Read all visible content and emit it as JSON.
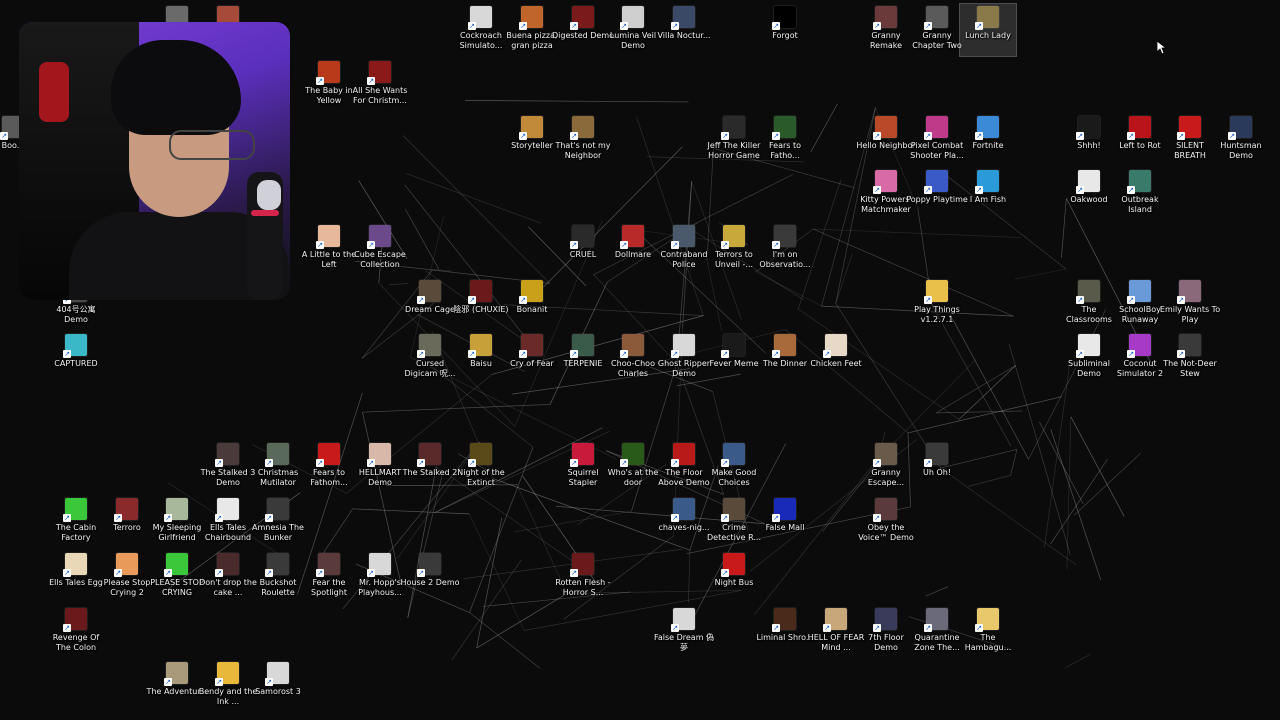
{
  "icons": [
    {
      "label": "Cockroach Simulato...",
      "color": "#d8d8d8"
    },
    {
      "label": "Buena pizza, gran pizza",
      "color": "#c0662c"
    },
    {
      "label": "Digested Demo",
      "color": "#7a1a1a"
    },
    {
      "label": "Lumina Veil Demo",
      "color": "#cfcfcf"
    },
    {
      "label": "Villa Noctur...",
      "color": "#3a4a66"
    },
    {
      "label": "Forgot",
      "color": "#000000"
    },
    {
      "label": "Granny Remake",
      "color": "#6a3a3a"
    },
    {
      "label": "Granny Chapter Two",
      "color": "#5a5a5a"
    },
    {
      "label": "Lunch Lady",
      "color": "#8a7a4a"
    },
    {
      "label": "The Baby in Yellow",
      "color": "#b83a1a"
    },
    {
      "label": "All She Wants For Christm...",
      "color": "#8a1a1a"
    },
    {
      "label": "Storyteller",
      "color": "#c08a3a"
    },
    {
      "label": "That's not my Neighbor",
      "color": "#8a6a3a"
    },
    {
      "label": "Jeff The Killer Horror Game",
      "color": "#2a2a2a"
    },
    {
      "label": "Fears to Fatho...",
      "color": "#2a5a2a"
    },
    {
      "label": "Hello Neighbor",
      "color": "#b84a2a"
    },
    {
      "label": "Pixel Combat Shooter Pla...",
      "color": "#c03a8a"
    },
    {
      "label": "Fortnite",
      "color": "#3a8ad8"
    },
    {
      "label": "Shhh!",
      "color": "#1a1a1a"
    },
    {
      "label": "Left to Rot",
      "color": "#b8141a"
    },
    {
      "label": "SILENT BREATH",
      "color": "#c81a1a"
    },
    {
      "label": "Huntsman Demo",
      "color": "#2a3a5a"
    },
    {
      "label": "Kitty Powers' Matchmaker",
      "color": "#d86aa8"
    },
    {
      "label": "Poppy Playtime",
      "color": "#3a5ac8"
    },
    {
      "label": "I Am Fish",
      "color": "#2a9ad8"
    },
    {
      "label": "Oakwood",
      "color": "#e8e8e8"
    },
    {
      "label": "Outbreak Island",
      "color": "#3a7a6a"
    },
    {
      "label": "A Little to the Left",
      "color": "#e8b89a"
    },
    {
      "label": "Cube Escape Collection",
      "color": "#6a4a8a"
    },
    {
      "label": "CRUEL",
      "color": "#2a2a2a"
    },
    {
      "label": "Dollmare",
      "color": "#b82a2a"
    },
    {
      "label": "Contraband Police",
      "color": "#4a5a6a"
    },
    {
      "label": "Terrors to Unveil -...",
      "color": "#c8a83a"
    },
    {
      "label": "I'm on Observatio...",
      "color": "#3a3a3a"
    },
    {
      "label": "404号公寓 Demo",
      "color": "#4a4a4a"
    },
    {
      "label": "CAPTURED",
      "color": "#3ab8c8"
    },
    {
      "label": "Dream Cage",
      "color": "#5a4a3a"
    },
    {
      "label": "陰邪 (CHUXIE)",
      "color": "#6a1a1a"
    },
    {
      "label": "Bonanit",
      "color": "#c8a01a"
    },
    {
      "label": "Play Things v1.2.7.1",
      "color": "#e8c04a"
    },
    {
      "label": "The Classrooms",
      "color": "#5a5a4a"
    },
    {
      "label": "SchoolBoy Runaway",
      "color": "#6a9ad8"
    },
    {
      "label": "Emily Wants To Play",
      "color": "#8a6a7a"
    },
    {
      "label": "Cursed Digicam 呪...",
      "color": "#6a6a5a"
    },
    {
      "label": "Baisu",
      "color": "#c8a03a"
    },
    {
      "label": "Cry of Fear",
      "color": "#6a2a2a"
    },
    {
      "label": "TERPENIE",
      "color": "#3a5a4a"
    },
    {
      "label": "Choo-Choo Charles",
      "color": "#8a5a3a"
    },
    {
      "label": "Ghost Ripper Demo",
      "color": "#d8d8d8"
    },
    {
      "label": "Fever Meme",
      "color": "#1a1a1a"
    },
    {
      "label": "The Dinner",
      "color": "#a86a3a"
    },
    {
      "label": "Chicken Feet",
      "color": "#e8d8c8"
    },
    {
      "label": "Subliminal Demo",
      "color": "#e8e8e8"
    },
    {
      "label": "Coconut Simulator 2",
      "color": "#a83ac8"
    },
    {
      "label": "The Not-Deer Stew",
      "color": "#3a3a3a"
    },
    {
      "label": "The Stalked 3 Demo",
      "color": "#4a3a3a"
    },
    {
      "label": "Christmas Mutilator",
      "color": "#5a6a5a"
    },
    {
      "label": "Fears to Fathom...",
      "color": "#c81a1a"
    },
    {
      "label": "HELLMART Demo",
      "color": "#d8b8a8"
    },
    {
      "label": "The Stalked 2",
      "color": "#5a2a2a"
    },
    {
      "label": "Night of the Extinct",
      "color": "#5a4a1a"
    },
    {
      "label": "Squirrel Stapler",
      "color": "#c81a3a"
    },
    {
      "label": "Who's at the door",
      "color": "#2a5a1a"
    },
    {
      "label": "The Floor Above Demo",
      "color": "#b81a1a"
    },
    {
      "label": "Make Good Choices",
      "color": "#3a5a8a"
    },
    {
      "label": "Granny Escape...",
      "color": "#6a5a4a"
    },
    {
      "label": "Uh Oh!",
      "color": "#3a3a3a"
    },
    {
      "label": "The Cabin Factory",
      "color": "#3ac83a"
    },
    {
      "label": "Terroro",
      "color": "#8a2a2a"
    },
    {
      "label": "My Sleeping Girlfriend",
      "color": "#a8b89a"
    },
    {
      "label": "Ells Tales Chairbound",
      "color": "#e8e8e8"
    },
    {
      "label": "Amnesia The Bunker",
      "color": "#3a3a3a"
    },
    {
      "label": "chaves-nig...",
      "color": "#3a5a8a"
    },
    {
      "label": "Crime Detective R...",
      "color": "#5a4a3a"
    },
    {
      "label": "False Mall",
      "color": "#1a2ab8"
    },
    {
      "label": "Obey the Voice™ Demo",
      "color": "#5a3a3a"
    },
    {
      "label": "Ells Tales Egg",
      "color": "#e8d8b8"
    },
    {
      "label": "Please Stop Crying 2",
      "color": "#e89a5a"
    },
    {
      "label": "PLEASE STOP CRYING",
      "color": "#3ac83a"
    },
    {
      "label": "Don't drop the cake ...",
      "color": "#4a2a2a"
    },
    {
      "label": "Buckshot Roulette",
      "color": "#3a3a3a"
    },
    {
      "label": "Fear the Spotlight",
      "color": "#5a3a3a"
    },
    {
      "label": "Mr. Hopp's Playhous...",
      "color": "#d8d8d8"
    },
    {
      "label": "House 2 Demo",
      "color": "#3a3a3a"
    },
    {
      "label": "Rotten Flesh - Horror S...",
      "color": "#6a1a1a"
    },
    {
      "label": "Night Bus",
      "color": "#c81a1a"
    },
    {
      "label": "Revenge Of The Colon",
      "color": "#6a1a1a"
    },
    {
      "label": "False Dream 偽夢",
      "color": "#d8d8d8"
    },
    {
      "label": "Liminal Shro...",
      "color": "#4a2a1a"
    },
    {
      "label": "HELL OF FEAR Mind ...",
      "color": "#c8a87a"
    },
    {
      "label": "7th Floor Demo",
      "color": "#3a3a5a"
    },
    {
      "label": "Quarantine Zone The...",
      "color": "#6a6a7a"
    },
    {
      "label": "The Hambagu...",
      "color": "#e8c86a"
    },
    {
      "label": "The Adventur...",
      "color": "#a89a7a"
    },
    {
      "label": "Bendy and the Ink ...",
      "color": "#e8b83a"
    },
    {
      "label": "Samorost 3",
      "color": "#d8d8d8"
    },
    {
      "label": "Boo...",
      "color": "#5a5a5a"
    },
    {
      "label": "",
      "color": "#6a6a6a"
    },
    {
      "label": "",
      "color": "#a84a3a"
    }
  ]
}
